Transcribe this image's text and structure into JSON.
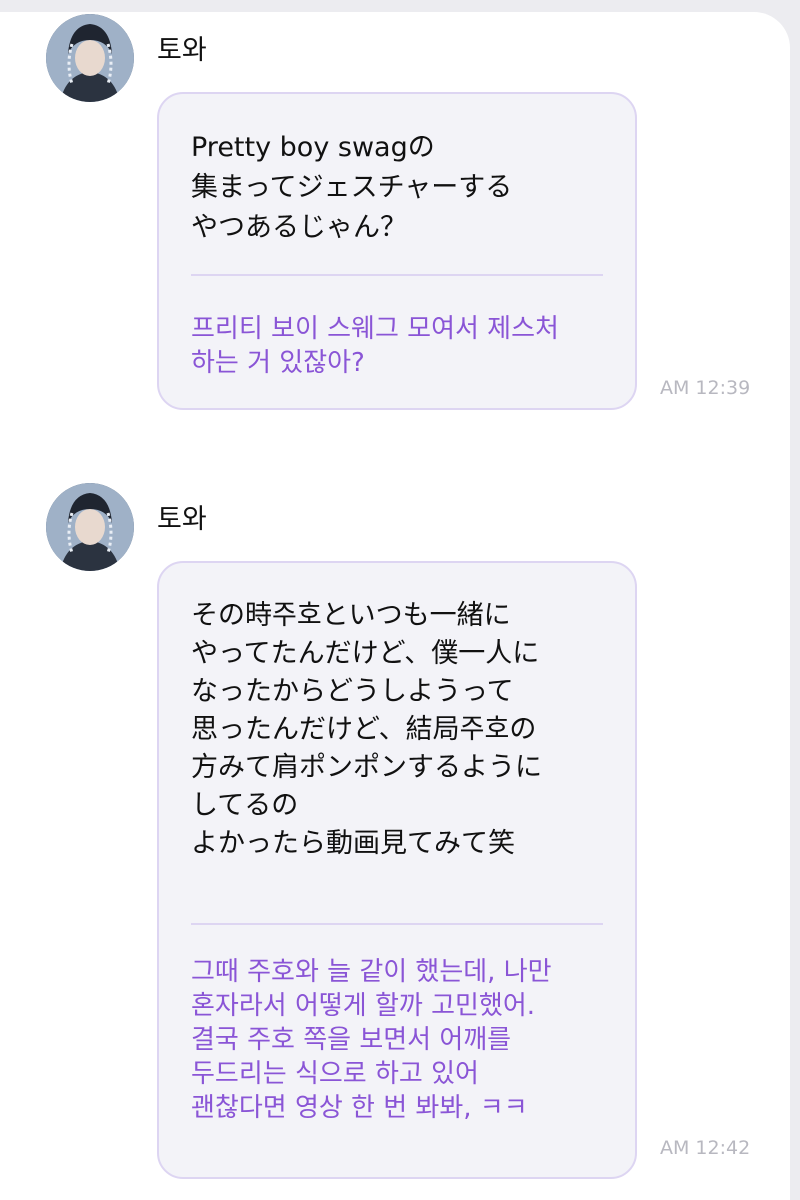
{
  "messages": [
    {
      "sender": "토와",
      "original": "Pretty boy swagの\n集まってジェスチャーする\nやつあるじゃん？",
      "translation": "프리티 보이 스웨그 모여서 제스처\n하는 거 있잖아?",
      "time": "AM 12:39",
      "avatar_icon": "profile-photo-icon"
    },
    {
      "sender": "토와",
      "original": "その時주호といつも一緒に\nやってたんだけど、僕一人に\nなったからどうしようって\n思ったんだけど、結局주호の\n方みて肩ポンポンするように\nしてるの\nよかったら動画見てみて笑",
      "translation": "그때 주호와 늘 같이 했는데, 나만\n혼자라서 어떻게 할까 고민했어.\n결국 주호 쪽을 보면서 어깨를\n두드리는 식으로 하고 있어\n괜찮다면 영상 한 번 봐봐, ㅋㅋ",
      "time": "AM 12:42",
      "avatar_icon": "profile-photo-icon"
    }
  ],
  "colors": {
    "bubble_bg": "#f3f3f8",
    "bubble_border": "#ddd5f2",
    "translation_text": "#8a55d6",
    "time_text": "#b8b8c0"
  }
}
